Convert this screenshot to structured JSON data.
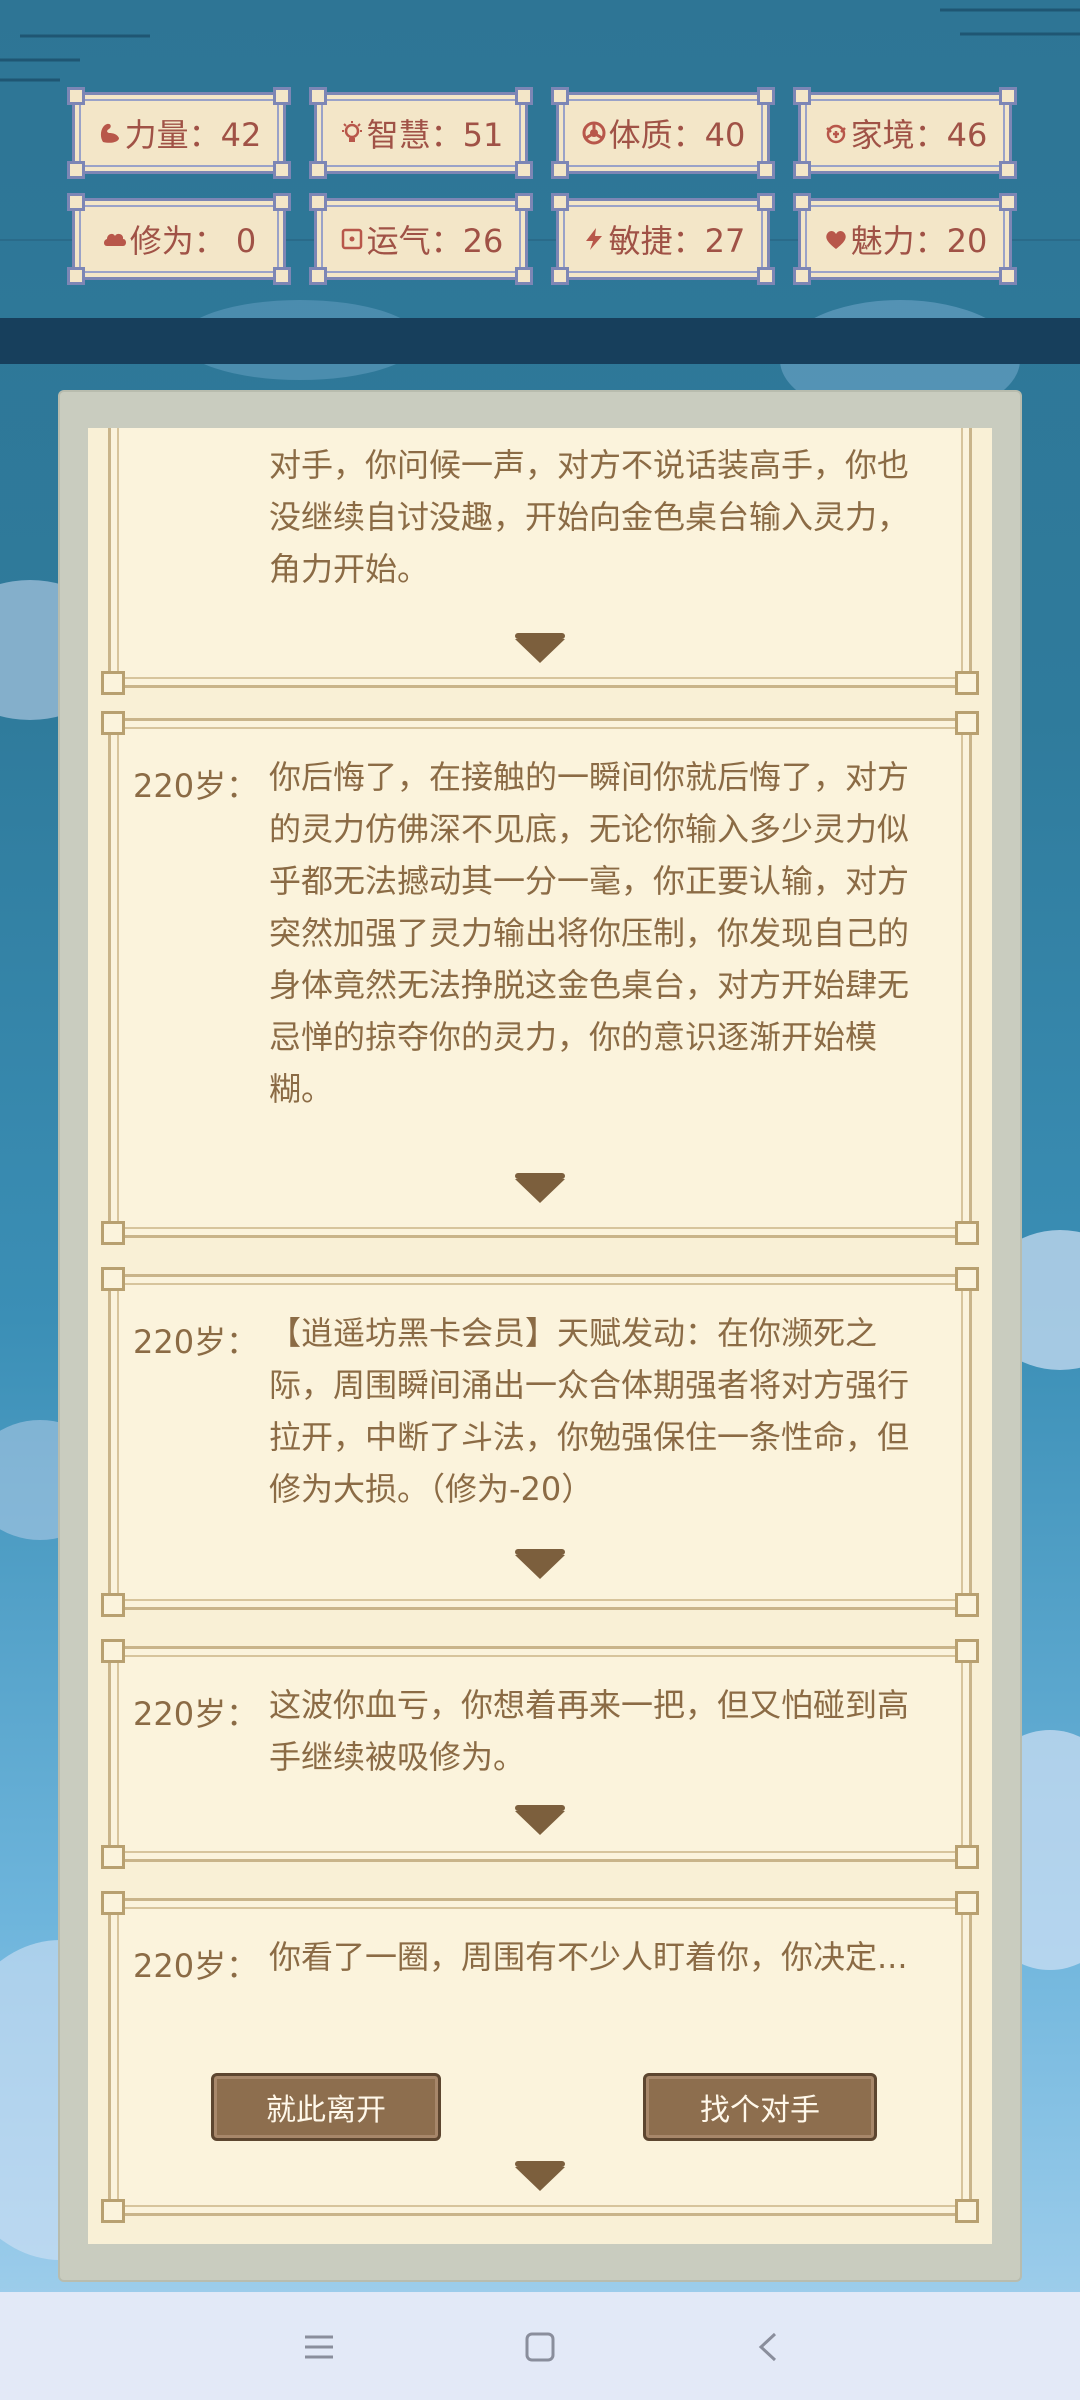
{
  "stats": [
    {
      "name": "strength",
      "label": "力量：42",
      "icon": "arm-icon"
    },
    {
      "name": "wisdom",
      "label": "智慧：51",
      "icon": "bulb-icon"
    },
    {
      "name": "constitution",
      "label": "体质：40",
      "icon": "body-icon"
    },
    {
      "name": "family",
      "label": "家境：46",
      "icon": "wealth-icon"
    },
    {
      "name": "cultivation",
      "label": "修为： 0",
      "icon": "cloud-icon"
    },
    {
      "name": "luck",
      "label": "运气：26",
      "icon": "dice-icon"
    },
    {
      "name": "agility",
      "label": "敏捷：27",
      "icon": "bolt-icon"
    },
    {
      "name": "charm",
      "label": "魅力：20",
      "icon": "heart-icon"
    }
  ],
  "events": [
    {
      "age": "",
      "text": "对手，你问候一声，对方不说话装高手，你也没继续自讨没趣，开始向金色桌台输入灵力，角力开始。"
    },
    {
      "age": "220岁：",
      "text": "你后悔了，在接触的一瞬间你就后悔了，对方的灵力仿佛深不见底，无论你输入多少灵力似乎都无法撼动其一分一毫，你正要认输，对方突然加强了灵力输出将你压制，你发现自己的身体竟然无法挣脱这金色桌台，对方开始肆无忌惮的掠夺你的灵力，你的意识逐渐开始模糊。"
    },
    {
      "age": "220岁：",
      "text": "【逍遥坊黑卡会员】天赋发动：在你濒死之际，周围瞬间涌出一众合体期强者将对方强行拉开，中断了斗法，你勉强保住一条性命，但修为大损。（修为-20）"
    },
    {
      "age": "220岁：",
      "text": "这波你血亏，你想着再来一把，但又怕碰到高手继续被吸修为。"
    },
    {
      "age": "220岁：",
      "text": "你看了一圈，周围有不少人盯着你，你决定..."
    }
  ],
  "choices": {
    "leave": "就此离开",
    "challenge": "找个对手"
  },
  "nav": {
    "menu_icon": "menu-icon",
    "home_icon": "square-icon",
    "back_icon": "back-icon"
  },
  "colors": {
    "text": "#8b6b45",
    "badge_text": "#a05246",
    "badge_border": "#7d86b5",
    "button": "#8d6e4e"
  }
}
